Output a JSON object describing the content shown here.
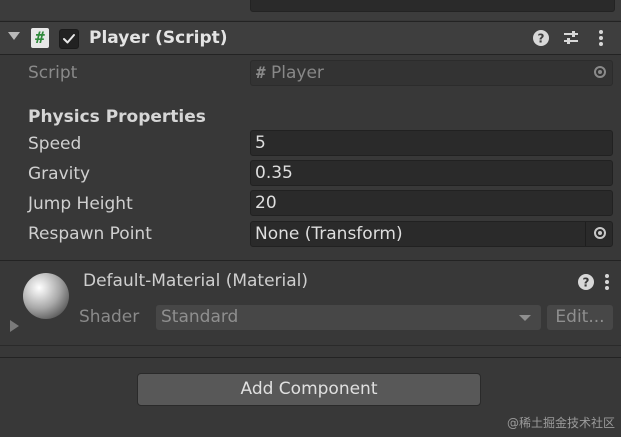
{
  "player_component": {
    "title": "Player (Script)",
    "enabled": true,
    "script": {
      "label": "Script",
      "value": "Player"
    },
    "section_header": "Physics Properties",
    "properties": [
      {
        "label": "Speed",
        "value": "5"
      },
      {
        "label": "Gravity",
        "value": "0.35"
      },
      {
        "label": "Jump Height",
        "value": "20"
      },
      {
        "label": "Respawn Point",
        "value": "None (Transform)"
      }
    ],
    "header_icons": [
      "help-icon",
      "presets-icon",
      "more-options-icon"
    ]
  },
  "material": {
    "title": "Default-Material (Material)",
    "shader_label": "Shader",
    "shader_value": "Standard",
    "edit_label": "Edit...",
    "header_icons": [
      "help-icon",
      "more-options-icon"
    ]
  },
  "add_component_label": "Add Component",
  "watermark": "@稀土掘金技术社区",
  "colors": {
    "background": "#383838",
    "field": "#2a2a2a",
    "script_icon_accent": "#2f8a3b"
  }
}
